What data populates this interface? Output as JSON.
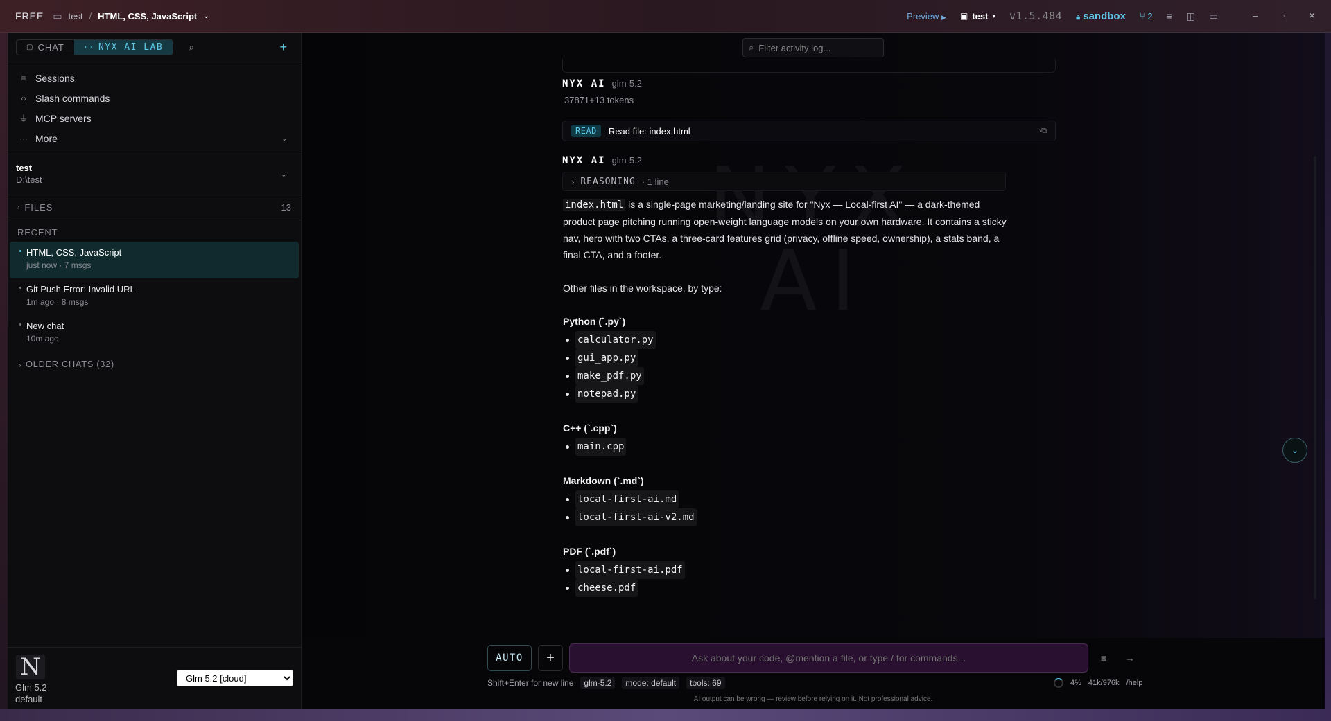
{
  "titlebar": {
    "plan": "FREE",
    "folder": "test",
    "separator": "/",
    "chat_title": "HTML, CSS, JavaScript",
    "preview_label": "Preview",
    "workspace": "test",
    "version": "v1.5.484",
    "sandbox_label": "sandbox",
    "branch_count": "2"
  },
  "sidebar": {
    "tab_chat": "CHAT",
    "tab_lab": "NYX AI LAB",
    "nav": [
      {
        "label": "Sessions",
        "icon": "list-icon"
      },
      {
        "label": "Slash commands",
        "icon": "code-icon"
      },
      {
        "label": "MCP servers",
        "icon": "plug-icon"
      },
      {
        "label": "More",
        "icon": "ellipsis-icon"
      }
    ],
    "workspace": {
      "name": "test",
      "path": "D:\\test"
    },
    "files_label": "FILES",
    "files_count": "13",
    "recent_label": "RECENT",
    "recent": [
      {
        "title": "HTML, CSS, JavaScript",
        "meta": "just now · 7 msgs"
      },
      {
        "title": "Git Push Error: Invalid URL",
        "meta": "1m ago · 8 msgs"
      },
      {
        "title": "New chat",
        "meta": "10m ago"
      }
    ],
    "older_label": "OLDER CHATS (32)",
    "logo_letter": "N",
    "model_name": "Glm 5.2",
    "model_mode": "default",
    "model_select": "Glm 5.2 [cloud]"
  },
  "main": {
    "filter_placeholder": "Filter activity log...",
    "msg1": {
      "who": "NYX AI",
      "model": "glm-5.2",
      "tokens": "37871+13 tokens"
    },
    "read": {
      "badge": "READ",
      "label": "Read file: index.html"
    },
    "msg2": {
      "who": "NYX AI",
      "model": "glm-5.2"
    },
    "reasoning": {
      "label": "REASONING",
      "count": "· 1 line"
    },
    "watermark_top": "NYX",
    "watermark_bottom": "AI",
    "answer": {
      "intro_code": "index.html",
      "intro_text": " is a single-page marketing/landing site for \"Nyx — Local-first AI\" — a dark-themed product page pitching running open-weight language models on your own hardware. It contains a sticky nav, hero with two CTAs, a three-card features grid (privacy, offline speed, ownership), a stats band, a final CTA, and a footer.",
      "other": "Other files in the workspace, by type:",
      "groups": [
        {
          "heading": "Python (`.py`)",
          "files": [
            "calculator.py",
            "gui_app.py",
            "make_pdf.py",
            "notepad.py"
          ]
        },
        {
          "heading": "C++ (`.cpp`)",
          "files": [
            "main.cpp"
          ]
        },
        {
          "heading": "Markdown (`.md`)",
          "files": [
            "local-first-ai.md",
            "local-first-ai-v2.md"
          ]
        },
        {
          "heading": "PDF (`.pdf`)",
          "files": [
            "local-first-ai.pdf",
            "cheese.pdf"
          ]
        }
      ]
    }
  },
  "composer": {
    "auto_label": "AUTO",
    "placeholder": "Ask about your code, @mention a file, or type / for commands...",
    "hint": "Shift+Enter for new line",
    "chip_model": "glm-5.2",
    "chip_mode": "mode: default",
    "chip_tools": "tools: 69",
    "context_pct": "4%",
    "context_tokens": "41k/976k",
    "help": "/help",
    "disclaimer": "AI output can be wrong — review before relying on it. Not professional advice."
  }
}
